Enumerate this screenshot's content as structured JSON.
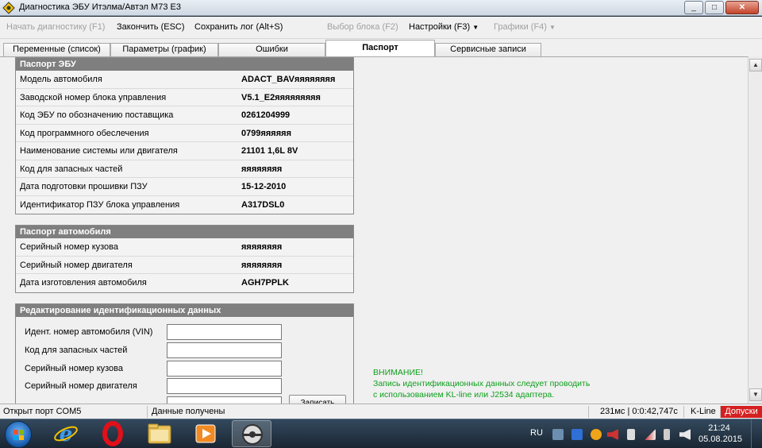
{
  "window": {
    "title": "Диагностика ЭБУ Итэлма/Автэл М73 Е3",
    "min": "_",
    "max": "□",
    "close": "✕"
  },
  "toolbar": {
    "start_diag": "Начать диагностику (F1)",
    "finish": "Закончить (ESC)",
    "save_log": "Сохранить лог (Alt+S)",
    "select_block": "Выбор блока (F2)",
    "settings": "Настройки (F3)",
    "graphs": "Графики (F4)"
  },
  "tabs": [
    {
      "label": "Переменные (список)"
    },
    {
      "label": "Параметры (график)"
    },
    {
      "label": "Ошибки"
    },
    {
      "label": "Паспорт"
    },
    {
      "label": "Сервисные записи"
    }
  ],
  "ecu_passport": {
    "title": "Паспорт ЭБУ",
    "rows": [
      {
        "label": "Модель автомобиля",
        "value": "ADACT_BAVяяяяяяяя"
      },
      {
        "label": "Заводской номер блока управления",
        "value": "V5.1_E2яяяяяяяяя"
      },
      {
        "label": "Код ЭБУ по обозначению поставщика",
        "value": "0261204999"
      },
      {
        "label": "Код программного обеслечения",
        "value": "0799яяяяяя"
      },
      {
        "label": "Наименование системы или двигателя",
        "value": "21101 1,6L 8V"
      },
      {
        "label": "Код для запасных частей",
        "value": "яяяяяяяя"
      },
      {
        "label": "Дата подготовки прошивки ПЗУ",
        "value": "15-12-2010"
      },
      {
        "label": "Идентификатор ПЗУ блока управления",
        "value": "A317DSL0"
      }
    ]
  },
  "car_passport": {
    "title": "Паспорт автомобиля",
    "rows": [
      {
        "label": "Серийный номер кузова",
        "value": "яяяяяяяя"
      },
      {
        "label": "Серийный номер двигателя",
        "value": "яяяяяяяя"
      },
      {
        "label": "Дата изготовления автомобиля",
        "value": "AGH7PPLK"
      }
    ]
  },
  "edit": {
    "title": "Редактирование идентификационных данных",
    "fields": [
      {
        "label": "Идент. номер автомобиля (VIN)",
        "value": ""
      },
      {
        "label": "Код для запасных частей",
        "value": ""
      },
      {
        "label": "Серийный номер кузова",
        "value": ""
      },
      {
        "label": "Серийный номер двигателя",
        "value": ""
      }
    ],
    "write_label": "Записать"
  },
  "warning": {
    "line1": "ВНИМАНИЕ!",
    "line2": "Запись идентификационных данных следует проводить",
    "line3": "с использованием KL-line или J2534 адаптера."
  },
  "status": {
    "port": "Открыт порт COM5",
    "data": "Данные получены",
    "timing": "231мс | 0:0:42,747с",
    "line": "K-Line",
    "alert": "Допуски"
  },
  "taskbar": {
    "lang": "RU",
    "time": "21:24",
    "date": "05.08.2015"
  },
  "colors": {
    "panel_header": "#7f7f7f",
    "warning": "#0d9f1b",
    "alert": "#d42020"
  }
}
